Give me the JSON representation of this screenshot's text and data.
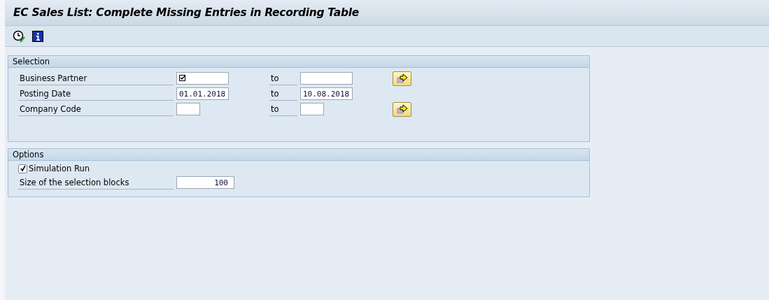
{
  "window": {
    "title": "EC Sales List: Complete Missing Entries in Recording Table"
  },
  "toolbar": [
    {
      "kind": "execute"
    },
    {
      "kind": "info"
    }
  ],
  "selection": {
    "title": "Selection",
    "rows": [
      {
        "label": "Business Partner",
        "kind": "long",
        "low": {
          "required": true
        },
        "to": "to",
        "high": {},
        "multiple_selection": true
      },
      {
        "label": "Posting Date",
        "kind": "long",
        "low": {
          "value": "01.01.2018"
        },
        "to": "to",
        "high": {
          "value": "10.08.2018"
        },
        "multiple_selection": false
      },
      {
        "label": "Company Code",
        "kind": "short",
        "low": {},
        "to": "to",
        "high": {},
        "multiple_selection": true
      }
    ]
  },
  "options": {
    "title": "Options",
    "items": [
      {
        "kind": "checkbox",
        "label": "Simulation Run",
        "checked": true
      },
      {
        "kind": "field",
        "label": "Size of the selection blocks",
        "value": "100"
      }
    ]
  }
}
